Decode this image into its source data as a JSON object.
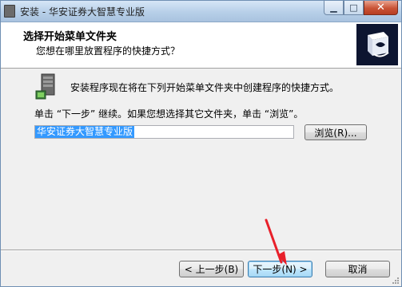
{
  "window": {
    "title": "安装 - 华安证券大智慧专业版",
    "minimize_icon": "minimize-icon",
    "maximize_icon": "maximize-icon",
    "close_icon": "close-icon"
  },
  "header": {
    "title": "选择开始菜单文件夹",
    "subtitle": "您想在哪里放置程序的快捷方式？"
  },
  "content": {
    "description": "安装程序现在将在下列开始菜单文件夹中创建程序的快捷方式。",
    "instruction": "单击 “下一步” 继续。如果您想选择其它文件夹，单击 “浏览”。",
    "folder_value": "华安证券大智慧专业版",
    "browse_label": "浏览(R)..."
  },
  "footer": {
    "back_label": "< 上一步(B)",
    "next_label": "下一步(N) >",
    "cancel_label": "取消"
  },
  "colors": {
    "selection": "#3399ff",
    "annotation_arrow": "#e8202a",
    "logo_bg": "#0d1530"
  }
}
